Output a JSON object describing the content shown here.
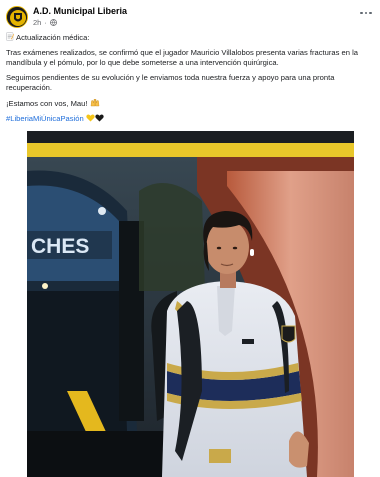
{
  "post": {
    "page_name": "A.D. Municipal Liberia",
    "time": "2h",
    "paragraphs": {
      "p1": "Actualización médica:",
      "p2": "Tras exámenes realizados, se confirmó que el jugador Mauricio Villalobos presenta varias fracturas en la mandíbula y el pómulo, por lo que debe someterse a una intervención quirúrgica.",
      "p3": "Seguimos pendientes de su evolución y le enviamos toda nuestra fuerza y apoyo para una pronta recuperación.",
      "p4": "¡Estamos con vos, Mau!"
    },
    "hashtag": "#LiberiaMiÚnicaPasión",
    "bus_sign_text": "CHES",
    "icons": [
      "globe-icon",
      "more-options-icon",
      "memo-icon",
      "raised-hands-icon",
      "yellow-heart-icon",
      "black-heart-icon"
    ]
  }
}
